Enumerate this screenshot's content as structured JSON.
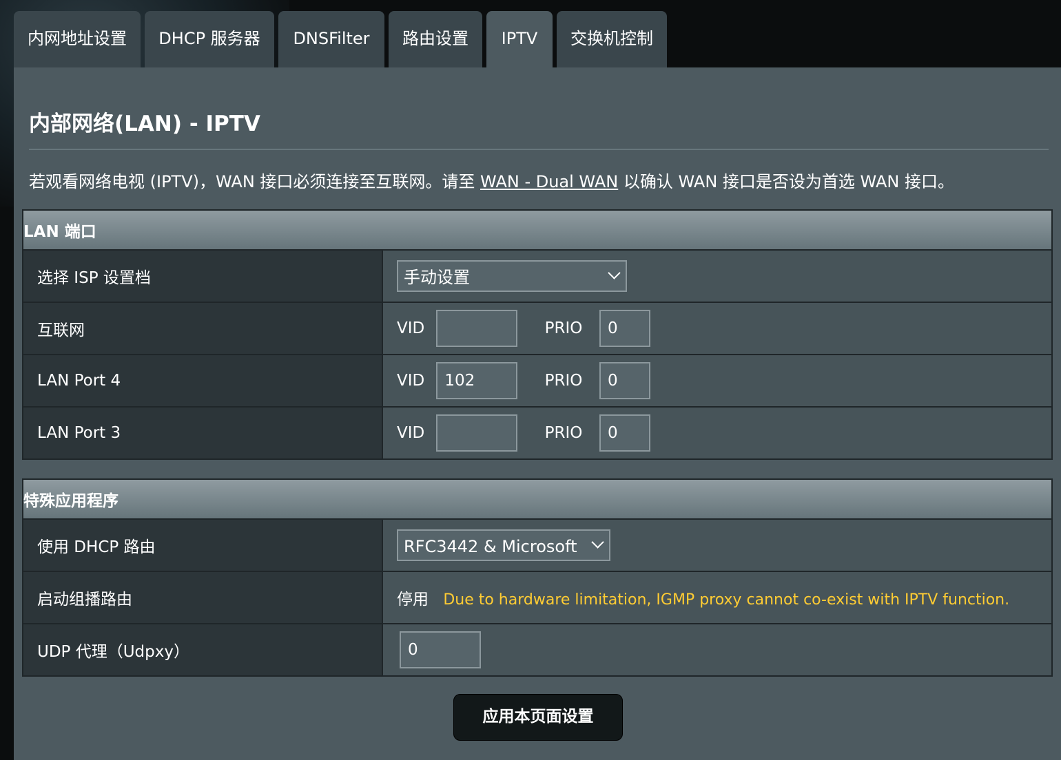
{
  "tabs": [
    {
      "label": "内网地址设置",
      "active": false
    },
    {
      "label": "DHCP 服务器",
      "active": false
    },
    {
      "label": "DNSFilter",
      "active": false
    },
    {
      "label": "路由设置",
      "active": false
    },
    {
      "label": "IPTV",
      "active": true
    },
    {
      "label": "交换机控制",
      "active": false
    }
  ],
  "page": {
    "title": "内部网络(LAN) - IPTV",
    "notice_before": "若观看网络电视 (IPTV)，WAN 接口必须连接至互联网。请至 ",
    "notice_link": "WAN - Dual WAN",
    "notice_after": " 以确认 WAN 接口是否设为首选 WAN 接口。"
  },
  "lan_section": {
    "header": "LAN 端口",
    "isp_profile": {
      "label": "选择 ISP 设置档",
      "value": "手动设置"
    },
    "vid_label": "VID",
    "prio_label": "PRIO",
    "rows": [
      {
        "label": "互联网",
        "vid": "",
        "prio": "0"
      },
      {
        "label": "LAN Port 4",
        "vid": "102",
        "prio": "0"
      },
      {
        "label": "LAN Port 3",
        "vid": "",
        "prio": "0"
      }
    ]
  },
  "special_section": {
    "header": "特殊应用程序",
    "dhcp_route": {
      "label": "使用 DHCP 路由",
      "value": "RFC3442 & Microsoft"
    },
    "multicast": {
      "label": "启动组播路由",
      "status": "停用",
      "warning": "Due to hardware limitation, IGMP proxy cannot co-exist with IPTV function."
    },
    "udpxy": {
      "label": "UDP 代理（Udpxy）",
      "value": "0"
    }
  },
  "apply_button": "应用本页面设置",
  "colors": {
    "warning": "#ffcc33",
    "panel": "#4d5a60"
  }
}
